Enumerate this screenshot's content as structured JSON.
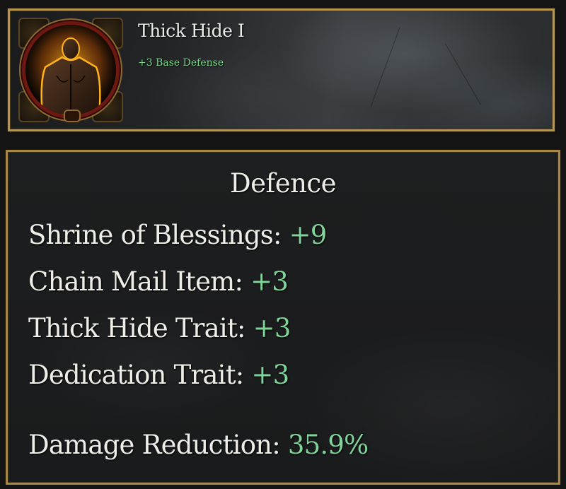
{
  "trait": {
    "title": "Thick Hide I",
    "bonus": "+3 Base Defense",
    "icon": "warrior-back-portrait-icon"
  },
  "defence": {
    "title": "Defence",
    "rows": [
      {
        "label": "Shrine of Blessings:",
        "value": "+9"
      },
      {
        "label": "Chain Mail Item:",
        "value": "+3"
      },
      {
        "label": "Thick Hide Trait:",
        "value": "+3"
      },
      {
        "label": "Dedication Trait:",
        "value": "+3"
      }
    ],
    "damage_reduction": {
      "label": "Damage Reduction:",
      "value": "35.9%"
    }
  },
  "colors": {
    "gold_border": "#b8944f",
    "positive_green": "#7fd49a",
    "text": "#eeede8",
    "background": "#141414"
  }
}
